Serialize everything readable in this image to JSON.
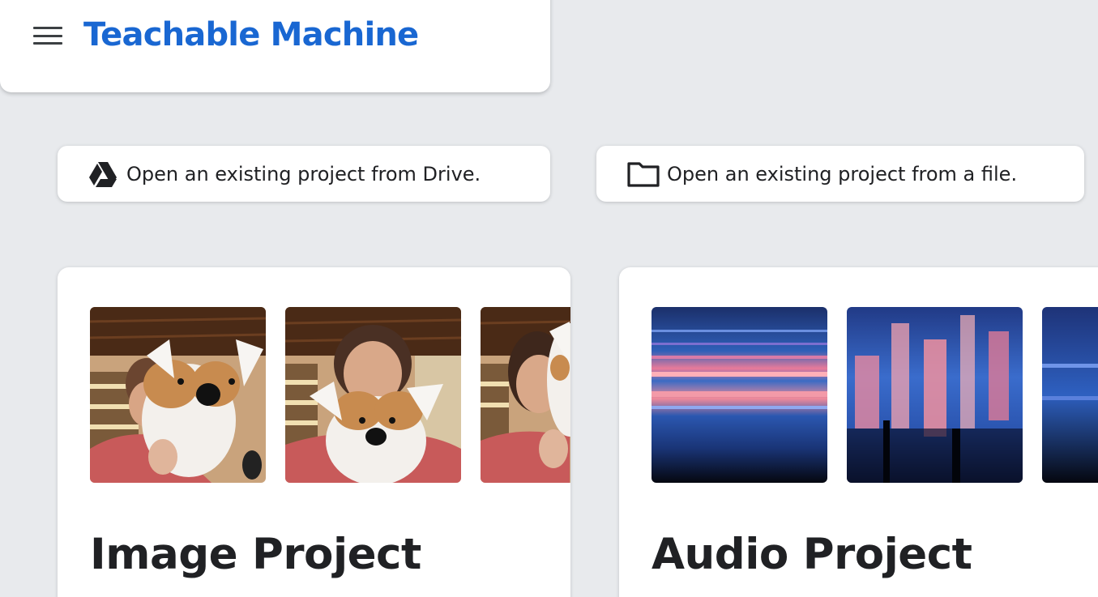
{
  "header": {
    "brand": "Teachable Machine",
    "brand_color": "#1967d2",
    "menu_icon": "hamburger-menu-icon"
  },
  "open_buttons": {
    "drive": {
      "label": "Open an existing project from Drive.",
      "icon": "google-drive-icon"
    },
    "file": {
      "label": "Open an existing project from a file.",
      "icon": "folder-icon"
    }
  },
  "projects": [
    {
      "title": "Image Project",
      "thumbnails": [
        "photo-person-with-plush-dog",
        "photo-person-with-plush-dog",
        "photo-person-with-plush-dog"
      ]
    },
    {
      "title": "Audio Project",
      "thumbnails": [
        "spectrogram",
        "spectrogram",
        "spectrogram"
      ]
    }
  ],
  "colors": {
    "background": "#e8eaed",
    "card": "#ffffff",
    "text": "#202124"
  }
}
